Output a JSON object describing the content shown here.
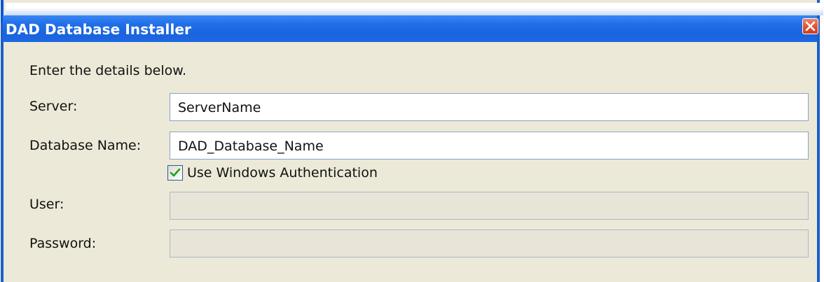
{
  "window": {
    "title": "DAD Database Installer"
  },
  "form": {
    "instruction": "Enter the details below.",
    "server_label": "Server:",
    "server_value": "ServerName",
    "database_label": "Database Name:",
    "database_value": "DAD_Database_Name",
    "windows_auth_label": "Use Windows Authentication",
    "windows_auth_checked": true,
    "user_label": "User:",
    "user_value": "",
    "password_label": "Password:",
    "password_value": ""
  },
  "colors": {
    "titlebar": "#1f6ee8",
    "close_button": "#dd4f2c",
    "window_background": "#ece9d8",
    "disabled_field": "#e8e4d8",
    "checkmark": "#21a121"
  },
  "icons": {
    "close": "close-icon",
    "check": "checkmark-icon"
  }
}
